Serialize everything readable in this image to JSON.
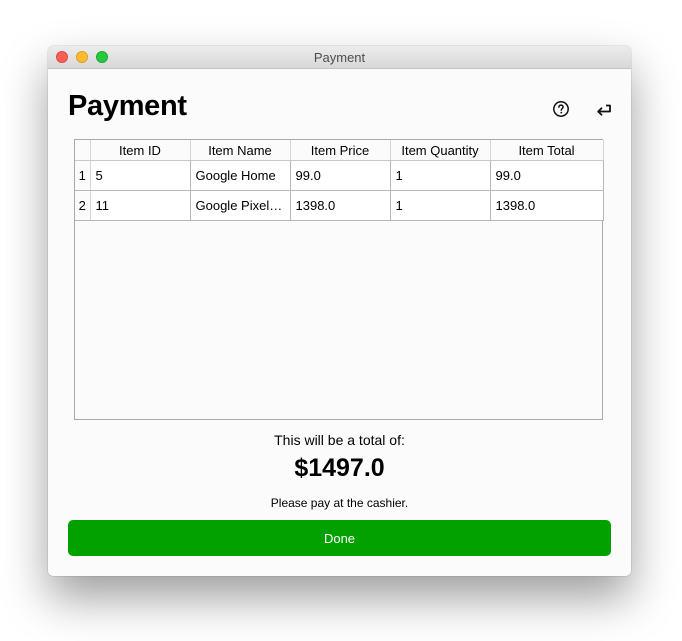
{
  "window": {
    "title": "Payment"
  },
  "header": {
    "title": "Payment",
    "help_icon": "question-circle-icon",
    "back_icon": "return-arrow-icon"
  },
  "table": {
    "columns": [
      "Item ID",
      "Item Name",
      "Item Price",
      "Item Quantity",
      "Item Total"
    ],
    "rows": [
      {
        "index": "1",
        "cells": [
          "5",
          "Google Home",
          "99.0",
          "1",
          "99.0"
        ]
      },
      {
        "index": "2",
        "cells": [
          "11",
          "Google Pixel…",
          "1398.0",
          "1",
          "1398.0"
        ]
      }
    ]
  },
  "summary": {
    "total_label": "This will be a total of:",
    "total_value": "$1497.0",
    "note": "Please pay at the cashier."
  },
  "actions": {
    "done_label": "Done"
  },
  "colors": {
    "done_button": "#03a100",
    "close": "#fc5f57",
    "minimize": "#fdbc2e",
    "maximize": "#28c840"
  }
}
